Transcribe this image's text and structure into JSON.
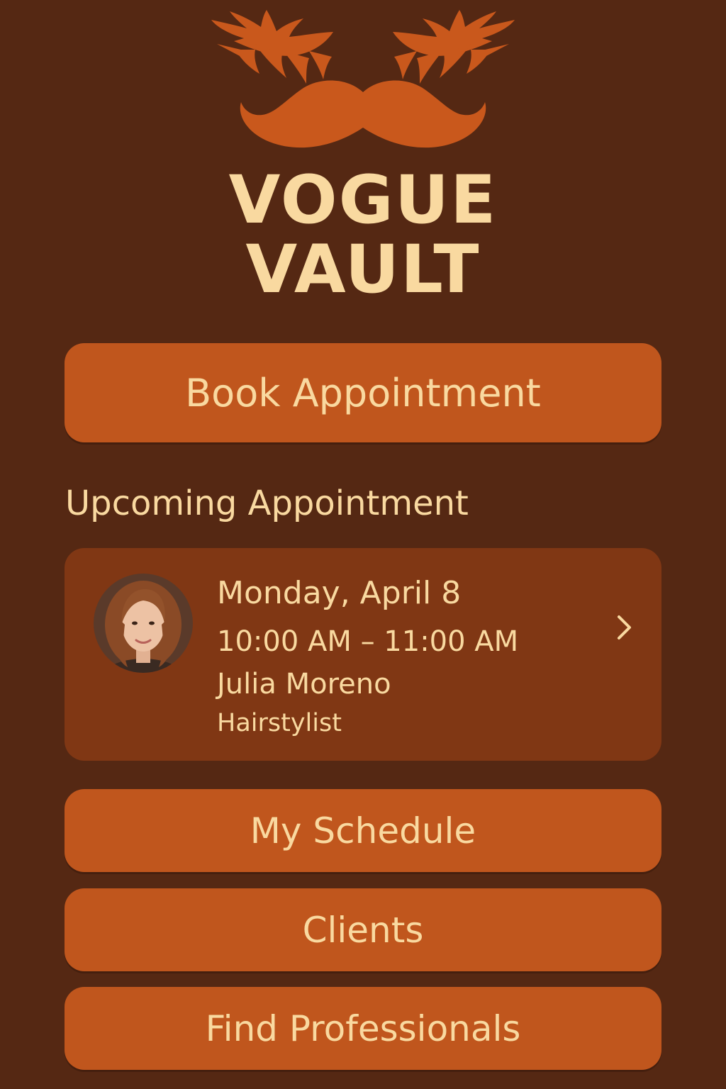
{
  "brand": {
    "line1": "VOGUE",
    "line2": "VAULT",
    "logo_icon": "lashes-mustache-logo"
  },
  "actions": {
    "book_label": "Book Appointment",
    "schedule_label": "My Schedule",
    "clients_label": "Clients",
    "find_label": "Find Professionals"
  },
  "upcoming": {
    "section_title": "Upcoming Appointment",
    "date": "Monday, April 8",
    "time": "10:00 AM – 11:00 AM",
    "stylist_name": "Julia Moreno",
    "stylist_role": "Hairstylist",
    "avatar_icon": "stylist-avatar",
    "chevron_icon": "chevron-right-icon"
  },
  "colors": {
    "background": "#552813",
    "accent": "#C0561D",
    "card": "#803714",
    "text": "#F9D9A0",
    "logo": "#D45F1F"
  }
}
